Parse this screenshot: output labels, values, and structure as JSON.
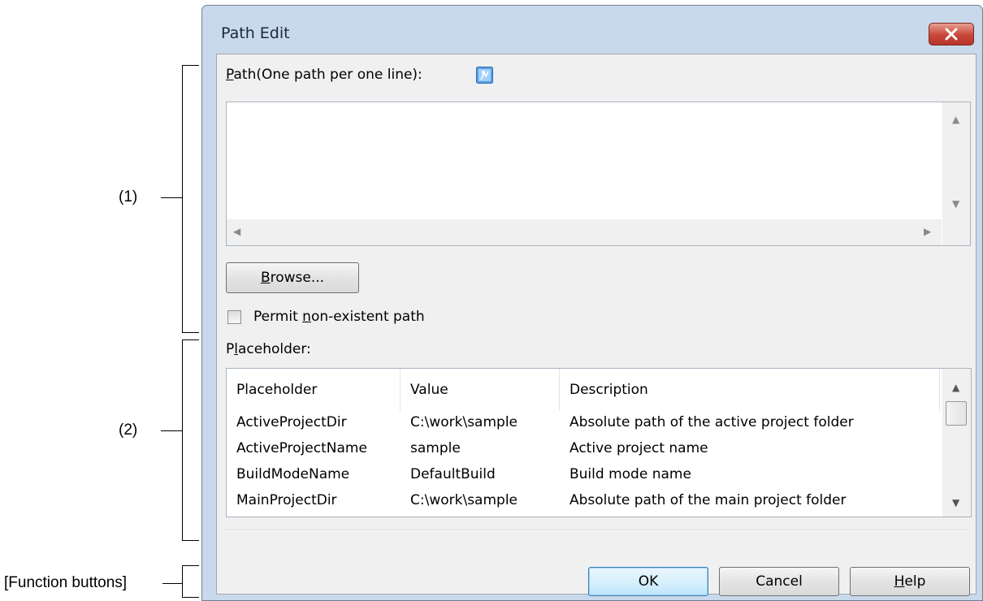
{
  "annotations": {
    "section1": "(1)",
    "section2": "(2)",
    "function_buttons": "[Function buttons]"
  },
  "dialog": {
    "title": "Path Edit",
    "path_label_accel": "P",
    "path_label_rest": "ath(One path per one line):",
    "path_value": "",
    "browse_accel": "B",
    "browse_rest": "rowse...",
    "permit_pre": "Permit ",
    "permit_accel": "n",
    "permit_post": "on-existent path",
    "permit_checked": false,
    "placeholder_label_pre": "P",
    "placeholder_label_accel": "l",
    "placeholder_label_post": "aceholder:",
    "table": {
      "headers": [
        "Placeholder",
        "Value",
        "Description"
      ],
      "rows": [
        [
          "ActiveProjectDir",
          "C:\\work\\sample",
          "Absolute path of the active project folder"
        ],
        [
          "ActiveProjectName",
          "sample",
          "Active project name"
        ],
        [
          "BuildModeName",
          "DefaultBuild",
          "Build mode name"
        ],
        [
          "MainProjectDir",
          "C:\\work\\sample",
          "Absolute path of the main project folder"
        ]
      ]
    },
    "buttons": {
      "ok": "OK",
      "cancel": "Cancel",
      "help_accel": "H",
      "help_rest": "elp"
    }
  },
  "colors": {
    "accent": "#3c7fb1",
    "close": "#c9463a"
  },
  "icons": {
    "close": "close-icon",
    "placeholder_hint": "placeholder-info-icon"
  }
}
